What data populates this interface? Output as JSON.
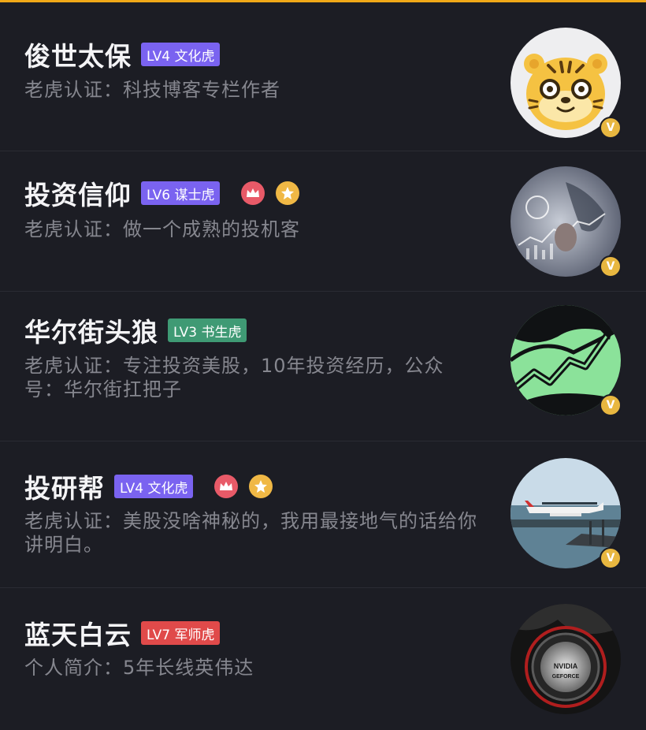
{
  "colors": {
    "background": "#1c1d24",
    "accent_top": "#f0a818",
    "level_purple": "#7a63f0",
    "level_green": "#3f9a74",
    "level_red": "#e04a4a",
    "verified_badge": "#e8b740"
  },
  "users": [
    {
      "name": "俊世太保",
      "level": "LV4 文化虎",
      "level_color": "purple",
      "medals": [],
      "description": "老虎认证：科技博客专栏作者",
      "avatar_icon": "tiger-mascot-avatar",
      "verified": true,
      "verified_mark": "V"
    },
    {
      "name": "投资信仰",
      "level": "LV6 谋士虎",
      "level_color": "purple",
      "medals": [
        "crown-medal-icon",
        "star-medal-icon"
      ],
      "description": "老虎认证：做一个成熟的投机客",
      "avatar_icon": "trading-screen-avatar",
      "verified": true,
      "verified_mark": "V"
    },
    {
      "name": "华尔街头狼",
      "level": "LV3 书生虎",
      "level_color": "green",
      "medals": [],
      "description": "老虎认证：专注投资美股，10年投资经历，公众号：华尔街扛把子",
      "avatar_icon": "green-chart-avatar",
      "verified": true,
      "verified_mark": "V"
    },
    {
      "name": "投研帮",
      "level": "LV4 文化虎",
      "level_color": "purple",
      "medals": [
        "crown-medal-icon",
        "star-medal-icon"
      ],
      "description": "老虎认证：美股没啥神秘的，我用最接地气的话给你讲明白。",
      "avatar_icon": "seaplane-avatar",
      "verified": true,
      "verified_mark": "V"
    },
    {
      "name": "蓝天白云",
      "level": "LV7 军师虎",
      "level_color": "red",
      "medals": [],
      "description": "个人简介：5年长线英伟达",
      "avatar_icon": "geforce-logo-avatar",
      "verified": false,
      "avatar_text_1": "NVIDIA",
      "avatar_text_2": "GEFORCE"
    }
  ]
}
